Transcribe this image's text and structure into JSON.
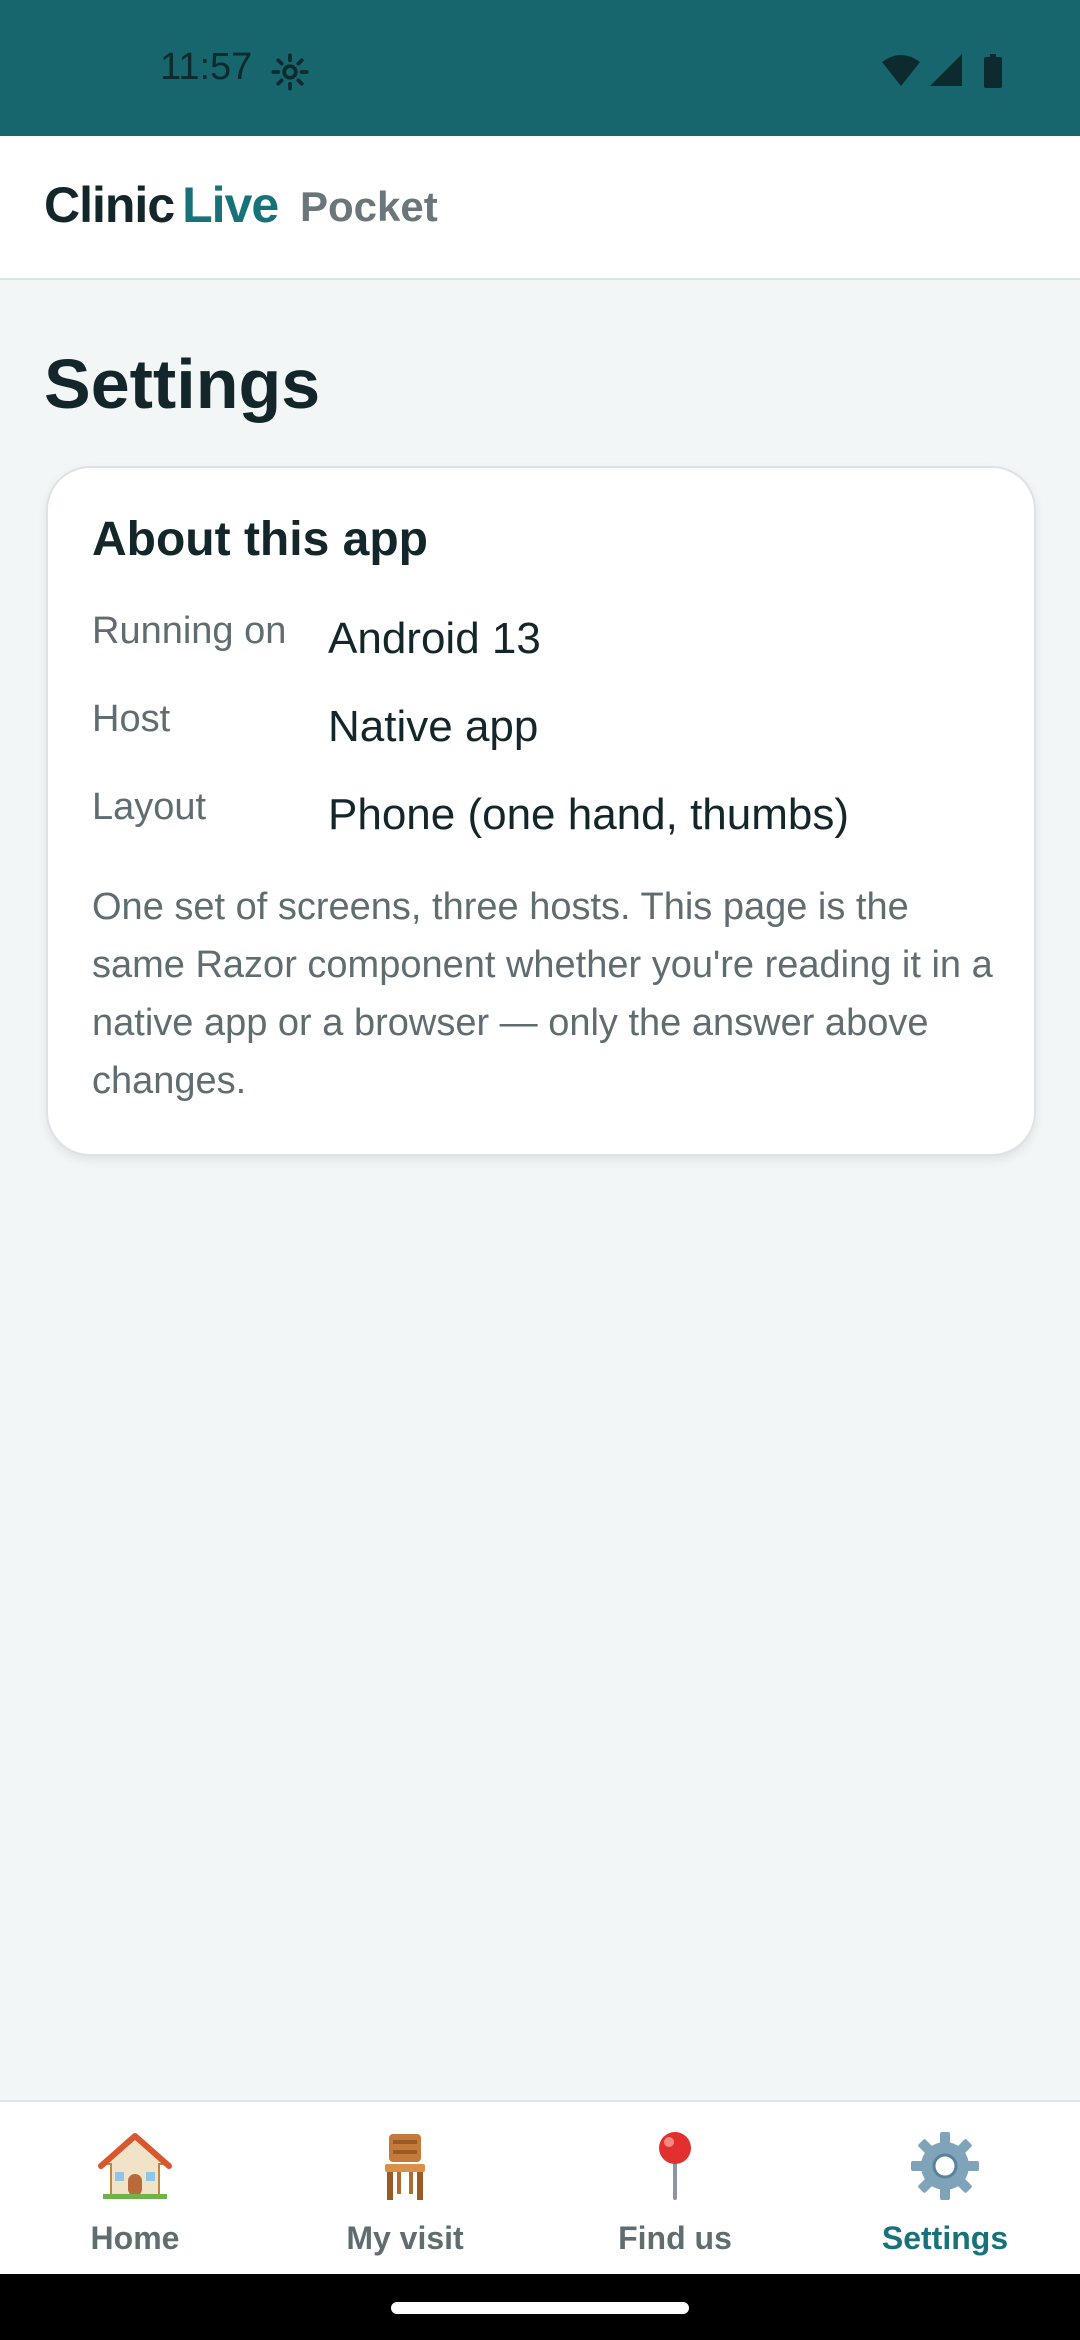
{
  "status_bar": {
    "time": "11:57",
    "icons": [
      "settings-gear-icon",
      "wifi-icon",
      "signal-icon",
      "battery-icon"
    ]
  },
  "header": {
    "brand_part1": "Clinic",
    "brand_part2": "Live",
    "brand_sub": "Pocket"
  },
  "page": {
    "title": "Settings"
  },
  "about_card": {
    "title": "About this app",
    "rows": [
      {
        "label": "Running on",
        "value": "Android 13"
      },
      {
        "label": "Host",
        "value": "Native app"
      },
      {
        "label": "Layout",
        "value": "Phone (one hand, thumbs)"
      }
    ],
    "note": "One set of screens, three hosts. This page is the same Razor component whether you're reading it in a native app or a browser — only the answer above changes."
  },
  "bottom_nav": {
    "items": [
      {
        "label": "Home",
        "icon": "house-icon",
        "active": false
      },
      {
        "label": "My visit",
        "icon": "chair-icon",
        "active": false
      },
      {
        "label": "Find us",
        "icon": "map-pin-icon",
        "active": false
      },
      {
        "label": "Settings",
        "icon": "gear-icon",
        "active": true
      }
    ]
  },
  "colors": {
    "status_bar": "#17666d",
    "accent": "#17727a",
    "background": "#f2f6f7",
    "text_primary": "#13262a",
    "text_secondary": "#5f6d71"
  }
}
